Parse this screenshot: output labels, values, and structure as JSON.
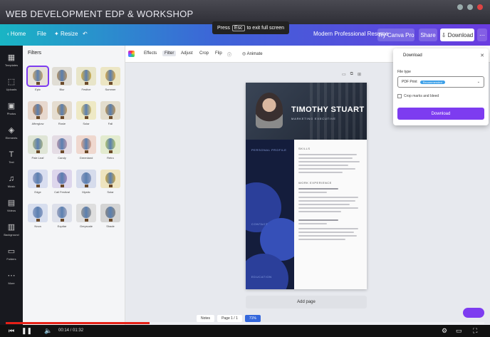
{
  "video": {
    "title": "WEB DEVELOPMENT EDP & WORKSHOP",
    "time": "00:14 / 01:32",
    "progress": 0.3
  },
  "header": {
    "home": "Home",
    "file": "File",
    "resize": "Resize",
    "doc_title": "Modern Professional Resume",
    "try_pro": "Try Canva Pro",
    "share": "Share",
    "download": "Download"
  },
  "tooltip": {
    "text": "Press",
    "key": "Esc",
    "suffix": "to exit full screen"
  },
  "rail": [
    {
      "icon": "▦",
      "label": "Templates"
    },
    {
      "icon": "⬚",
      "label": "Uploads"
    },
    {
      "icon": "▣",
      "label": "Photos"
    },
    {
      "icon": "◈",
      "label": "Elements"
    },
    {
      "icon": "T",
      "label": "Text"
    },
    {
      "icon": "♫",
      "label": "Music"
    },
    {
      "icon": "▤",
      "label": "Videos"
    },
    {
      "icon": "▥",
      "label": "Background"
    },
    {
      "icon": "▭",
      "label": "Folders"
    },
    {
      "icon": "⋯",
      "label": "More"
    }
  ],
  "panel": {
    "title": "Filters",
    "filters": [
      {
        "name": "Epic",
        "color": "#c9a870",
        "bg": "#e7e2d8"
      },
      {
        "name": "Blur",
        "color": "#b49368",
        "bg": "#e0ddd5"
      },
      {
        "name": "Festive",
        "color": "#d4b24a",
        "bg": "#e8e5c9"
      },
      {
        "name": "Summer",
        "color": "#d6aa50",
        "bg": "#ece6c4"
      },
      {
        "name": "Afterglow",
        "color": "#c78c5c",
        "bg": "#e7d8ce"
      },
      {
        "name": "Rosie",
        "color": "#c39c62",
        "bg": "#e5ddd0"
      },
      {
        "name": "Solar",
        "color": "#d7c275",
        "bg": "#eee9c5"
      },
      {
        "name": "Fall",
        "color": "#b8945c",
        "bg": "#e3ddcd"
      },
      {
        "name": "Pale Leaf",
        "color": "#a9b48c",
        "bg": "#dfe5d6"
      },
      {
        "name": "Candy",
        "color": "#b69ab0",
        "bg": "#e4dce4"
      },
      {
        "name": "Greenland",
        "color": "#d9a48a",
        "bg": "#efd8cf"
      },
      {
        "name": "Retro",
        "color": "#b0c478",
        "bg": "#e3ebcf"
      },
      {
        "name": "Edge",
        "color": "#9aa4c8",
        "bg": "#d9def0"
      },
      {
        "name": "Cali Festival",
        "color": "#a08cc0",
        "bg": "#ddd6ec"
      },
      {
        "name": "Mystic",
        "color": "#8f9ec2",
        "bg": "#d6dcec"
      },
      {
        "name": "Solar",
        "color": "#c8a648",
        "bg": "#eee4bf"
      },
      {
        "name": "Nova",
        "color": "#8ea0c6",
        "bg": "#d7deee"
      },
      {
        "name": "Equitar",
        "color": "#a2a8c2",
        "bg": "#dde0ea"
      },
      {
        "name": "Greyscale",
        "color": "#9a9a9a",
        "bg": "#dedede"
      },
      {
        "name": "Shade",
        "color": "#888888",
        "bg": "#d4d4d4"
      }
    ]
  },
  "toolbar": {
    "effects": "Effects",
    "filter": "Filter",
    "adjust": "Adjust",
    "crop": "Crop",
    "flip": "Flip",
    "animate": "Animate"
  },
  "resume": {
    "name": "TIMOTHY STUART",
    "subtitle": "MARKETING EXECUTIVE",
    "side_sections": [
      "PERSONAL PROFILE",
      "CONTACT",
      "EDUCATION"
    ],
    "main_sections": [
      "SKILLS",
      "WORK EXPERIENCE"
    ]
  },
  "add_page": "Add page",
  "bottom": {
    "notes": "Notes",
    "pages": "Page 1 / 1",
    "zoom": "71%"
  },
  "download_panel": {
    "title": "Download",
    "file_type_label": "File type",
    "file_type_value": "PDF Print",
    "badge": "Recommended",
    "checkbox": "Crop marks and bleed",
    "button": "Download"
  },
  "colors": {
    "accent": "#7d3cf0",
    "header_start": "#19b5c4",
    "header_end": "#6a3be0",
    "resume_dark": "#141d3c"
  }
}
